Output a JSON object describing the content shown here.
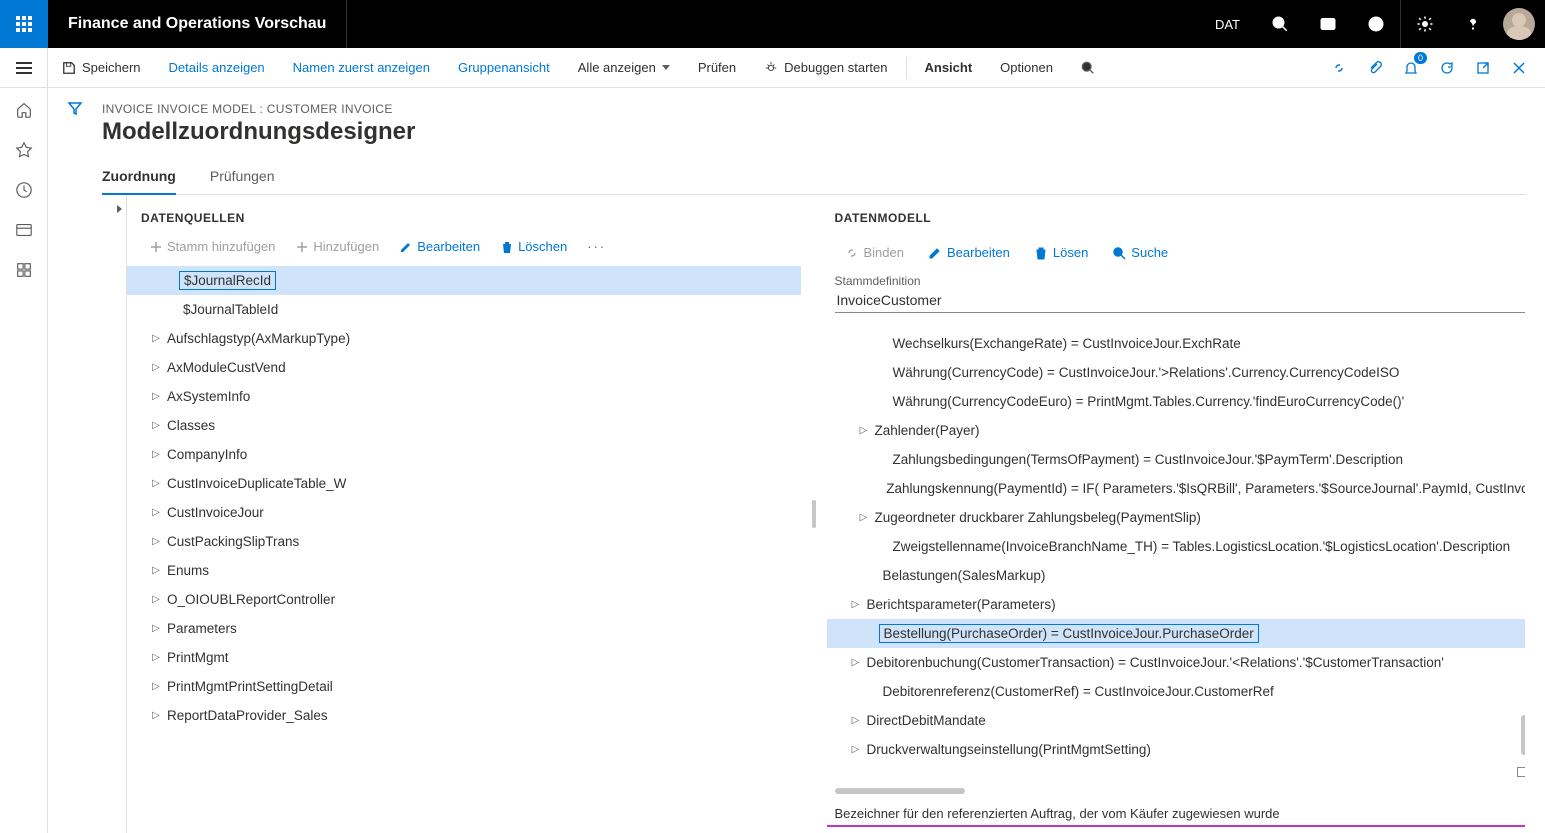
{
  "topbar": {
    "app_title": "Finance and Operations Vorschau",
    "company": "DAT"
  },
  "cmdbar": {
    "save": "Speichern",
    "show_details": "Details anzeigen",
    "names_first": "Namen zuerst anzeigen",
    "group_view": "Gruppenansicht",
    "show_all": "Alle anzeigen",
    "check": "Prüfen",
    "start_debug": "Debuggen starten",
    "view": "Ansicht",
    "options": "Optionen",
    "badge_count": "0"
  },
  "breadcrumb": "INVOICE INVOICE MODEL : CUSTOMER INVOICE",
  "page_title": "Modellzuordnungsdesigner",
  "tabs": {
    "mapping": "Zuordnung",
    "checks": "Prüfungen"
  },
  "left_panel": {
    "header": "DATENQUELLEN",
    "add_root": "Stamm hinzufügen",
    "add": "Hinzufügen",
    "edit": "Bearbeiten",
    "delete": "Löschen",
    "items": [
      {
        "label": "$JournalRecId",
        "caret": false,
        "selected": true,
        "indent": 38
      },
      {
        "label": "$JournalTableId",
        "caret": false,
        "indent": 38
      },
      {
        "label": "Aufschlagstyp(AxMarkupType)",
        "caret": true,
        "indent": 22
      },
      {
        "label": "AxModuleCustVend",
        "caret": true,
        "indent": 22
      },
      {
        "label": "AxSystemInfo",
        "caret": true,
        "indent": 22
      },
      {
        "label": "Classes",
        "caret": true,
        "indent": 22
      },
      {
        "label": "CompanyInfo",
        "caret": true,
        "indent": 22
      },
      {
        "label": "CustInvoiceDuplicateTable_W",
        "caret": true,
        "indent": 22
      },
      {
        "label": "CustInvoiceJour",
        "caret": true,
        "indent": 22
      },
      {
        "label": "CustPackingSlipTrans",
        "caret": true,
        "indent": 22
      },
      {
        "label": "Enums",
        "caret": true,
        "indent": 22
      },
      {
        "label": "O_OIOUBLReportController",
        "caret": true,
        "indent": 22
      },
      {
        "label": "Parameters",
        "caret": true,
        "indent": 22
      },
      {
        "label": "PrintMgmt",
        "caret": true,
        "indent": 22
      },
      {
        "label": "PrintMgmtPrintSettingDetail",
        "caret": true,
        "indent": 22
      },
      {
        "label": "ReportDataProvider_Sales",
        "caret": true,
        "indent": 22
      }
    ]
  },
  "right_panel": {
    "header": "DATENMODELL",
    "bind": "Binden",
    "edit": "Bearbeiten",
    "unbind": "Lösen",
    "search": "Suche",
    "root_label": "Stammdefinition",
    "root_value": "InvoiceCustomer",
    "items": [
      {
        "label": "Wechselkurs(ExchangeRate) = CustInvoiceJour.ExchRate",
        "caret": false,
        "indent": 48
      },
      {
        "label": "Währung(CurrencyCode) = CustInvoiceJour.'>Relations'.Currency.CurrencyCodeISO",
        "caret": false,
        "indent": 48
      },
      {
        "label": "Währung(CurrencyCodeEuro) = PrintMgmt.Tables.Currency.'findEuroCurrencyCode()'",
        "caret": false,
        "indent": 48
      },
      {
        "label": "Zahlender(Payer)",
        "caret": true,
        "indent": 30
      },
      {
        "label": "Zahlungsbedingungen(TermsOfPayment) = CustInvoiceJour.'$PaymTerm'.Description",
        "caret": false,
        "indent": 48
      },
      {
        "label": "Zahlungskennung(PaymentId) = IF( Parameters.'$IsQRBill', Parameters.'$SourceJournal'.PaymId, CustInvoiceJour.",
        "caret": false,
        "indent": 48
      },
      {
        "label": "Zugeordneter druckbarer Zahlungsbeleg(PaymentSlip)",
        "caret": true,
        "indent": 30
      },
      {
        "label": "Zweigstellenname(InvoiceBranchName_TH) = Tables.LogisticsLocation.'$LogisticsLocation'.Description",
        "caret": false,
        "indent": 48
      },
      {
        "label": "Belastungen(SalesMarkup)",
        "caret": false,
        "indent": 38
      },
      {
        "label": "Berichtsparameter(Parameters)",
        "caret": true,
        "indent": 22
      },
      {
        "label": "Bestellung(PurchaseOrder) = CustInvoiceJour.PurchaseOrder",
        "caret": false,
        "indent": 38,
        "selected": true
      },
      {
        "label": "Debitorenbuchung(CustomerTransaction) = CustInvoiceJour.'<Relations'.'$CustomerTransaction'",
        "caret": true,
        "indent": 22
      },
      {
        "label": "Debitorenreferenz(CustomerRef) = CustInvoiceJour.CustomerRef",
        "caret": false,
        "indent": 38
      },
      {
        "label": "DirectDebitMandate",
        "caret": true,
        "indent": 22
      },
      {
        "label": "Druckverwaltungseinstellung(PrintMgmtSetting)",
        "caret": true,
        "indent": 22
      }
    ],
    "footer": "Bezeichner für den referenzierten Auftrag, der vom Käufer zugewiesen wurde"
  }
}
